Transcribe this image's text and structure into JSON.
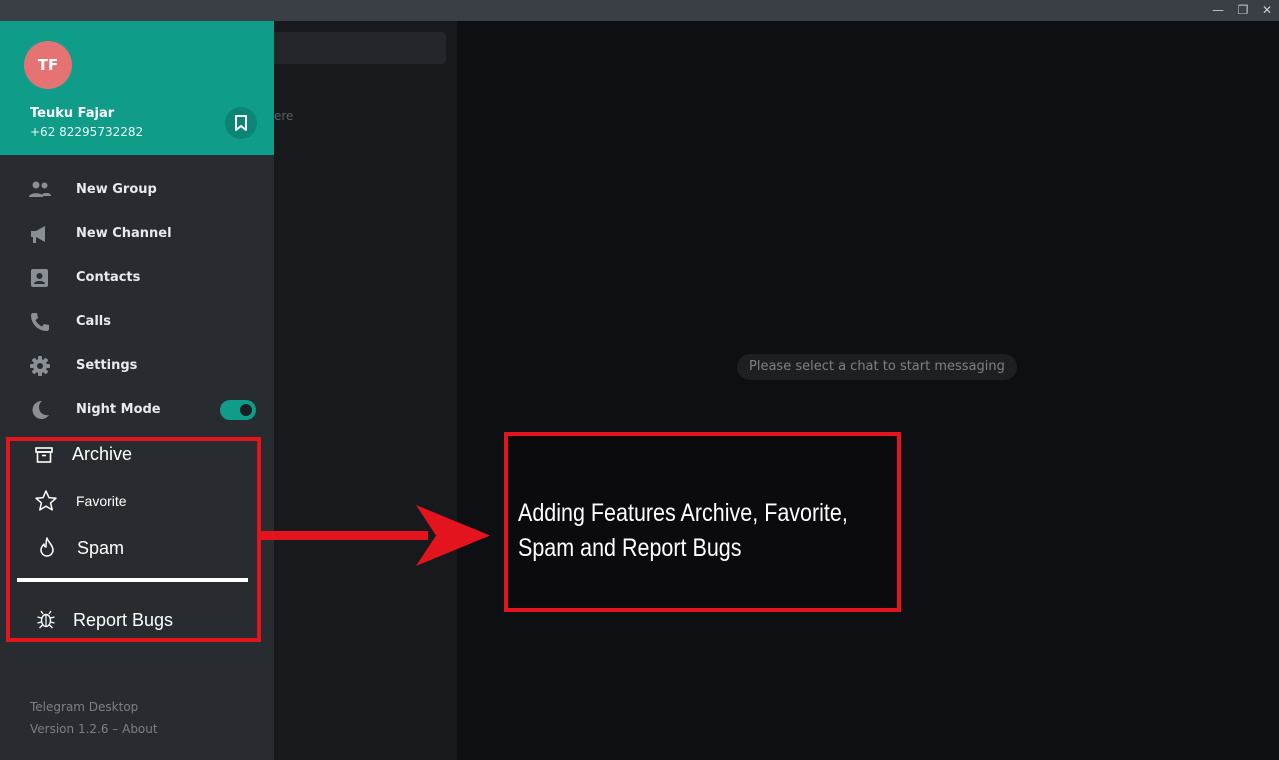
{
  "window": {
    "controls": [
      "—",
      "❐",
      "✕"
    ]
  },
  "profile": {
    "initials": "TF",
    "name": "Teuku Fajar",
    "phone": "+62 82295732282",
    "accent": "#0f9d8a",
    "avatar_color": "#e57373"
  },
  "menu": {
    "items": [
      {
        "label": "New Group",
        "icon": "group-icon"
      },
      {
        "label": "New Channel",
        "icon": "megaphone-icon"
      },
      {
        "label": "Contacts",
        "icon": "contact-card-icon"
      },
      {
        "label": "Calls",
        "icon": "phone-icon"
      },
      {
        "label": "Settings",
        "icon": "gear-icon"
      },
      {
        "label": "Night Mode",
        "icon": "moon-icon",
        "toggle_on": true
      }
    ]
  },
  "added_features": {
    "archive": "Archive",
    "favorite": "Favorite",
    "spam": "Spam",
    "report_bugs": "Report Bugs"
  },
  "chatlist": {
    "ghost_text": "ere"
  },
  "main": {
    "empty_message": "Please select a chat to start messaging"
  },
  "footer": {
    "app_name": "Telegram Desktop",
    "version": "Version 1.2.6 – About"
  },
  "annotation": {
    "text": "Adding Features Archive, Favorite, Spam and Report Bugs",
    "highlight_color": "#e4141e"
  }
}
